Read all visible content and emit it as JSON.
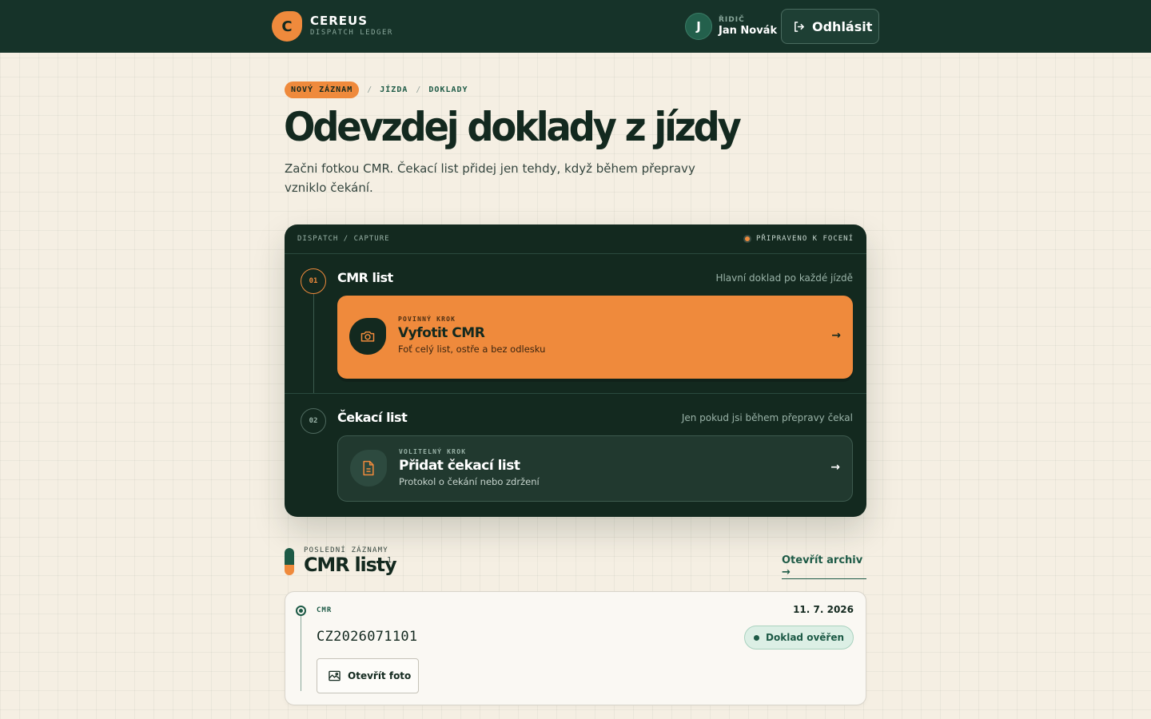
{
  "brand": {
    "logo_letter": "C",
    "name": "CEREUS",
    "subtitle": "DISPATCH LEDGER"
  },
  "user": {
    "initial": "J",
    "role": "ŘIDIČ",
    "name": "Jan Novák"
  },
  "header": {
    "logout_label": "Odhlásit"
  },
  "breadcrumb": {
    "badge": "NOVÝ ZÁZNAM",
    "sep1": "/",
    "item1": "JÍZDA",
    "sep2": "/",
    "item2": "DOKLADY"
  },
  "hero": {
    "title": "Odevzdej doklady z jízdy",
    "lead": "Začni fotkou CMR. Čekací list přidej jen tehdy, když během přepravy vzniklo čekání."
  },
  "capture": {
    "label": "DISPATCH / CAPTURE",
    "status": "PŘIPRAVENO K FOCENÍ",
    "steps": [
      {
        "number": "01",
        "title": "CMR list",
        "hint": "Hlavní doklad po každé jízdě",
        "action": {
          "kicker": "POVINNÝ KROK",
          "title": "Vyfotit CMR",
          "desc": "Foť celý list, ostře a bez odlesku",
          "arrow": "→"
        }
      },
      {
        "number": "02",
        "title": "Čekací list",
        "hint": "Jen pokud jsi během přepravy čekal",
        "action": {
          "kicker": "VOLITELNÝ KROK",
          "title": "Přidat čekací list",
          "desc": "Protokol o čekání nebo zdržení",
          "arrow": "→"
        }
      }
    ]
  },
  "recent": {
    "kicker": "POSLEDNÍ ZÁZNAMY",
    "title": "CMR listy",
    "count": "1",
    "archive_label": "Otevřít archiv →",
    "records": [
      {
        "type": "CMR",
        "date": "11. 7. 2026",
        "id": "CZ2026071101",
        "status": "Doklad ověřen",
        "open_label": "Otevřít foto"
      }
    ]
  },
  "colors": {
    "primary_dark": "#163329",
    "accent": "#ef8a3c",
    "green": "#1d5a46",
    "background": "#f5efe3"
  },
  "icons": {
    "logout": "logout-icon",
    "camera": "camera-icon",
    "document": "document-icon",
    "image": "image-icon"
  }
}
